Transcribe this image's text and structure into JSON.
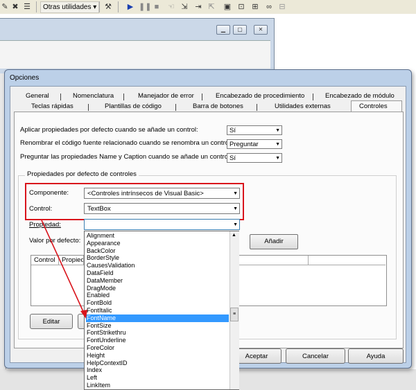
{
  "toolbar": {
    "otras_utilidades": "Otras utilidades ▾"
  },
  "dialog": {
    "title": "Opciones",
    "tabs_row1": [
      "General",
      "Nomenclatura",
      "Manejador de error",
      "Encabezado de procedimiento",
      "Encabezado de módulo"
    ],
    "tabs_row2": [
      "Teclas rápidas",
      "Plantillas de código",
      "Barra de botones",
      "Utilidades externas",
      "Controles"
    ],
    "questions": [
      {
        "label": "Aplicar propiedades por defecto cuando se añade un control:",
        "value": "Sí"
      },
      {
        "label": "Renombrar el código fuente relacionado cuando se renombra un control:",
        "value": "Preguntar"
      },
      {
        "label": "Preguntar las propiedades Name y Caption cuando se añade un control:",
        "value": "Sí"
      }
    ],
    "group_title": "Propiedades por defecto de controles",
    "componente_label": "Componente:",
    "componente_value": "<Controles intrínsecos de Visual Basic>",
    "control_label": "Control:",
    "control_value": "TextBox",
    "propiedad_label": "Propiedad:",
    "propiedad_value": "",
    "valor_label": "Valor por defecto:",
    "add_button": "Añadir",
    "grid_headers": [
      "Control",
      "Propieda"
    ],
    "edit_button": "Editar",
    "accept_button": "Aceptar",
    "cancel_button": "Cancelar",
    "help_button": "Ayuda"
  },
  "property_list": {
    "items": [
      "Alignment",
      "Appearance",
      "BackColor",
      "BorderStyle",
      "CausesValidation",
      "DataField",
      "DataMember",
      "DragMode",
      "Enabled",
      "FontBold",
      "FontItalic",
      "FontName",
      "FontSize",
      "FontStrikethru",
      "FontUnderline",
      "ForeColor",
      "Height",
      "HelpContextID",
      "Index",
      "Left",
      "LinkItem"
    ],
    "selected": "FontName"
  },
  "colors": {
    "highlight_box": "#d9141c",
    "selection": "#3399ff",
    "annotation_arrow": "#d9141c"
  }
}
